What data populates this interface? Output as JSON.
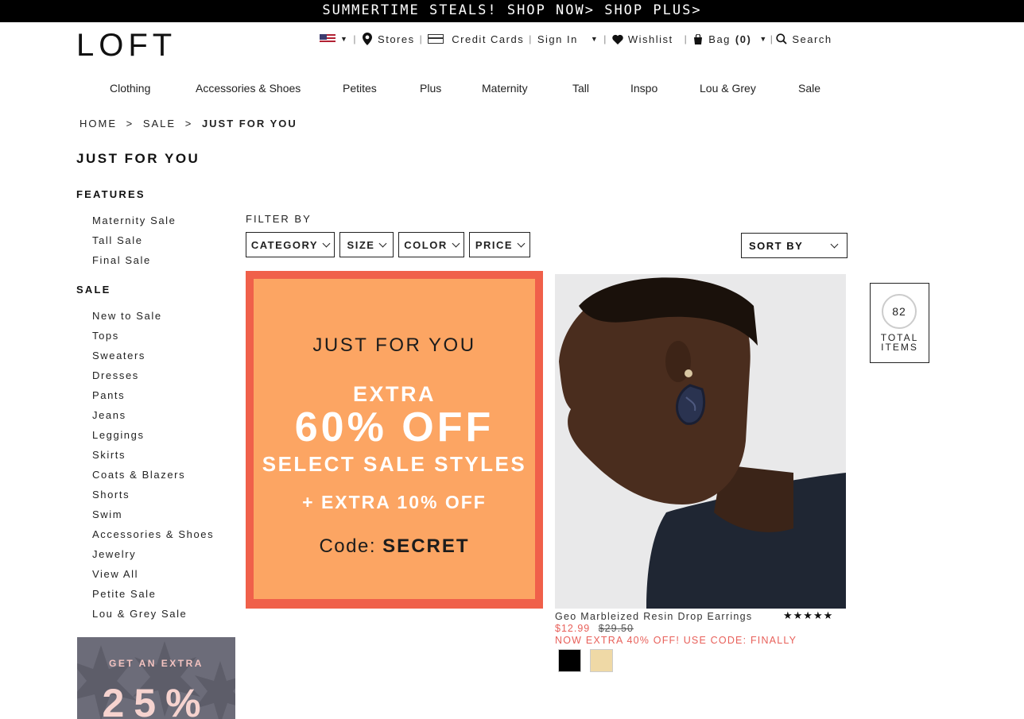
{
  "promo_bar": {
    "text": "SUMMERTIME STEALS! SHOP NOW> SHOP PLUS>"
  },
  "header": {
    "logo": "LOFT",
    "utility": {
      "stores": "Stores",
      "credit_cards": "Credit Cards",
      "sign_in": "Sign In",
      "wishlist": "Wishlist",
      "bag_label": "Bag",
      "bag_count": "(0)",
      "search": "Search"
    }
  },
  "nav": {
    "items": [
      "Clothing",
      "Accessories & Shoes",
      "Petites",
      "Plus",
      "Maternity",
      "Tall",
      "Inspo",
      "Lou & Grey",
      "Sale"
    ]
  },
  "breadcrumb": {
    "home": "HOME",
    "sale": "SALE",
    "current": "JUST FOR YOU",
    "separator": ">"
  },
  "sidebar": {
    "title": "JUST FOR YOU",
    "features_heading": "FEATURES",
    "features": [
      "Maternity Sale",
      "Tall Sale",
      "Final Sale"
    ],
    "sale_heading": "SALE",
    "sale_items": [
      "New to Sale",
      "Tops",
      "Sweaters",
      "Dresses",
      "Pants",
      "Jeans",
      "Leggings",
      "Skirts",
      "Coats & Blazers",
      "Shorts",
      "Swim",
      "Accessories & Shoes",
      "Jewelry",
      "View All",
      "Petite Sale",
      "Lou & Grey Sale"
    ],
    "promo": {
      "line1": "GET AN EXTRA",
      "line2": "25%"
    }
  },
  "filters": {
    "label": "FILTER BY",
    "buttons": [
      "CATEGORY",
      "SIZE",
      "COLOR",
      "PRICE"
    ],
    "sort_label": "SORT BY"
  },
  "banner": {
    "title": "JUST FOR YOU",
    "extra": "EXTRA",
    "percent": "60% OFF",
    "select": "SELECT SALE STYLES",
    "plus": "+ EXTRA 10% OFF",
    "code_label": "Code:",
    "code": "SECRET"
  },
  "product": {
    "name": "Geo Marbleized Resin Drop Earrings",
    "rating_stars": "★★★★★",
    "rating": 5,
    "sale_price": "$12.99",
    "original_price": "$29.50",
    "promo_text": "NOW EXTRA 40% OFF! USE CODE: FINALLY",
    "swatches": [
      "#000000",
      "#efd9a6"
    ]
  },
  "total": {
    "count": "82",
    "label_line1": "TOTAL",
    "label_line2": "ITEMS"
  }
}
